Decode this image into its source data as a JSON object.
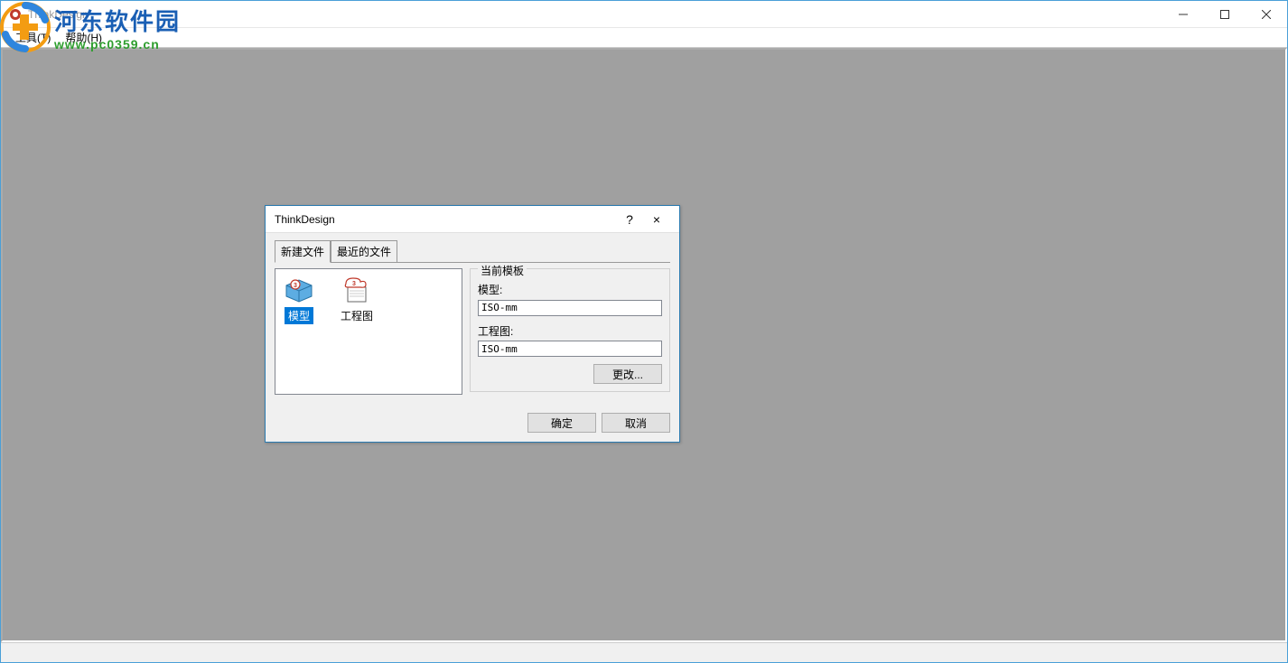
{
  "window": {
    "title": "ThinkDesign"
  },
  "menubar": {
    "tools": "工具(T)",
    "help": "帮助(H)"
  },
  "dialog": {
    "title": "ThinkDesign",
    "help_symbol": "?",
    "close_symbol": "×",
    "tabs": {
      "new_file": "新建文件",
      "recent_files": "最近的文件"
    },
    "file_types": {
      "model": "模型",
      "drawing": "工程图"
    },
    "template_group": {
      "legend": "当前模板",
      "model_label": "模型:",
      "model_value": "ISO-mm",
      "drawing_label": "工程图:",
      "drawing_value": "ISO-mm",
      "change_btn": "更改..."
    },
    "buttons": {
      "ok": "确定",
      "cancel": "取消"
    }
  },
  "watermark": {
    "name_cn": "河东软件园",
    "url": "www.pc0359.cn"
  }
}
